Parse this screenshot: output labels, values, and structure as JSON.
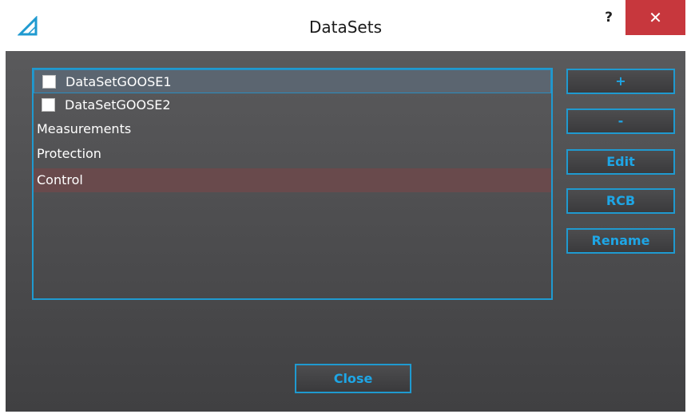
{
  "window": {
    "title": "DataSets",
    "help_label": "?",
    "close_symbol": "✕",
    "icon": "triangle-ruler-icon",
    "accent_color": "#1f9ad0",
    "close_color": "#c7373d"
  },
  "datasets": {
    "items": [
      {
        "label": "DataSetGOOSE1",
        "checkbox": true,
        "checked": false,
        "state": "hover"
      },
      {
        "label": "DataSetGOOSE2",
        "checkbox": true,
        "checked": false,
        "state": "normal"
      },
      {
        "label": "Measurements",
        "checkbox": false,
        "state": "normal"
      },
      {
        "label": "Protection",
        "checkbox": false,
        "state": "normal"
      },
      {
        "label": "Control",
        "checkbox": false,
        "state": "selected"
      }
    ]
  },
  "buttons": {
    "add_label": "+",
    "remove_label": "-",
    "edit_label": "Edit",
    "rcb_label": "RCB",
    "rename_label": "Rename",
    "close_label": "Close"
  }
}
